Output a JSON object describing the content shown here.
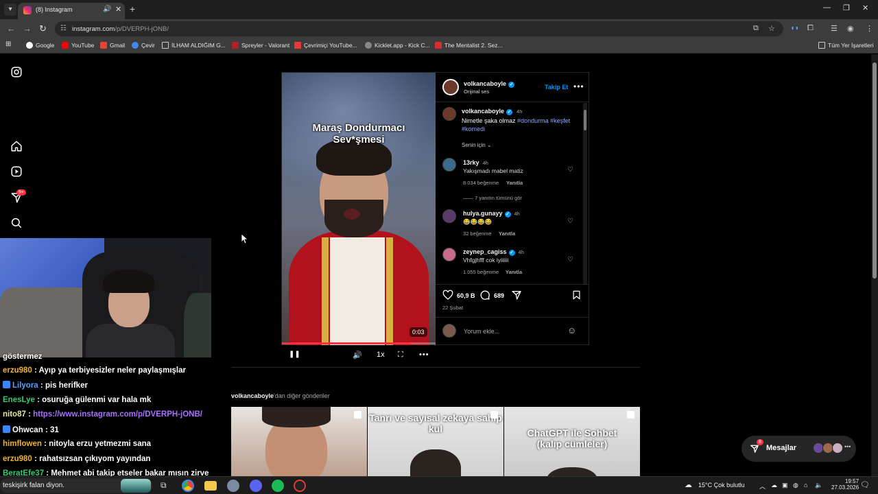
{
  "browser": {
    "tab_title": "(8) Instagram",
    "new_tab": "+",
    "url_host": "instagram.com",
    "url_path": "/p/DVERPH-jONB/",
    "bookmarks": [
      "Google",
      "YouTube",
      "Gmail",
      "Çevir",
      "İLHAM ALDIĞIM G...",
      "Spreyler - Valorant",
      "Çevrimiçi YouTube...",
      "Kicklet.app - Kick C...",
      "The Mentalist 2. Sez..."
    ],
    "all_bookmarks": "Tüm Yer İşaretleri"
  },
  "sidebar": {
    "badge": "9+"
  },
  "post": {
    "video_caption_line1": "Maraş Dondurmacı",
    "video_caption_line2": "Sev*şmesi",
    "video_time": "0:03",
    "video_progress": 0.84,
    "speed": "1x",
    "author": "volkancaboyle",
    "audio": "Orijinal ses",
    "follow": "Takip Et",
    "caption_time": "4h",
    "caption_text": "Nimetle şaka olmaz",
    "caption_tags": [
      "#dondurma",
      "#keşfet",
      "#komedi"
    ],
    "sort": "Senin için",
    "comments": [
      {
        "user": "13rky",
        "verified": false,
        "time": "4h",
        "text": "Yakışmadı mabel matiz",
        "likes": "8.034 beğenme",
        "reply": "Yanıtla"
      },
      {
        "user": "hulya.gunayy",
        "verified": true,
        "time": "4h",
        "text": "😂😂😂😂",
        "likes": "32 beğenme",
        "reply": "Yanıtla"
      },
      {
        "user": "zeynep_cagiss",
        "verified": true,
        "time": "4h",
        "text": "Vhfgjhfff cok iyiiiiii",
        "likes": "1.055 beğenme",
        "reply": "Yanıtla"
      }
    ],
    "view_replies": "7 yanıtın tümünü gör",
    "like_count": "60,9 B",
    "comment_count": "689",
    "date": "22 Şubat",
    "comment_placeholder": "Yorum ekle..."
  },
  "more_posts": {
    "user": "volkancaboyle",
    "suffix": "'dan diğer gönderiler",
    "thumbs": [
      {
        "text": ""
      },
      {
        "text": "Tanrı ve sayısal zekaya sahip kul"
      },
      {
        "text": "ChatGPT ile Sohbet (kalıp cümleler)"
      }
    ]
  },
  "messages": {
    "label": "Mesajlar",
    "badge": "8"
  },
  "chat": [
    {
      "user": "",
      "text": "göstermez",
      "color": "#ffffff"
    },
    {
      "user": "erzu980",
      "text": ": Ayıp ya terbiyesizler neler paylaşmışlar",
      "color": "#f0b429"
    },
    {
      "user": "Lilyora",
      "text": ": pis herifker",
      "color": "#3a86ff",
      "icon": true
    },
    {
      "user": "EnesLye",
      "text": ": osuruğa gülenmi var hala mk",
      "color": "#2ecc71"
    },
    {
      "user": "nito87",
      "text": ": ",
      "link": "https://www.instagram.com/p/DVERPH-jONB/",
      "color": "#ffffff"
    },
    {
      "user": "Ohwcan",
      "text": ": 31",
      "color": "#ffffff",
      "icon": true
    },
    {
      "user": "himflowen",
      "text": ": nitoyla erzu yetmezmi sana",
      "color": "#f0b429"
    },
    {
      "user": "erzu980",
      "text": ": rahatsızsan çıkıyom yayından",
      "color": "#f0b429"
    },
    {
      "user": "BeratEfe37",
      "text": ": Mehmet abi takip etseler bakar mısın zirve",
      "color": "#2ecc71"
    }
  ],
  "taskbar": {
    "search_text": "teskişirk falan diyon.",
    "weather": "15°C  Çok bulutlu",
    "time": "19:57",
    "date": "27.03.2026"
  }
}
